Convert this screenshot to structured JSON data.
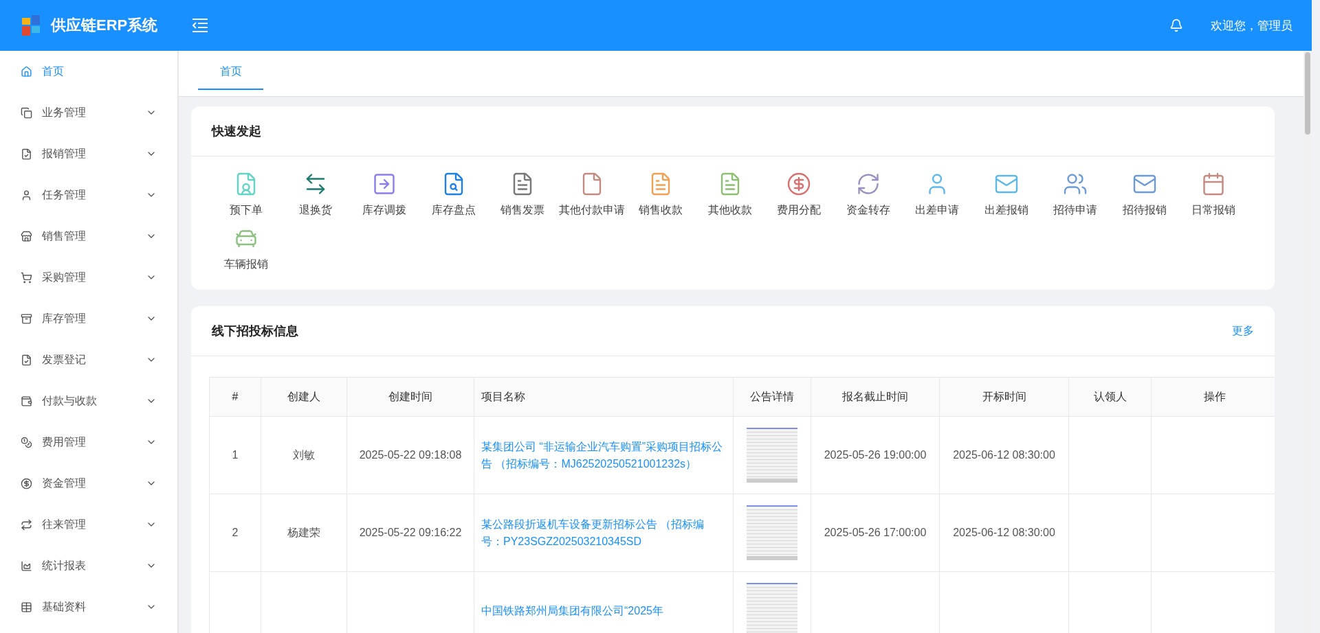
{
  "header": {
    "title": "供应链ERP系统",
    "greeting": "欢迎您，管理员"
  },
  "sidebar": {
    "items": [
      {
        "label": "首页",
        "kind": "home",
        "selected": true,
        "expandable": false
      },
      {
        "label": "业务管理",
        "kind": "window",
        "selected": false,
        "expandable": true
      },
      {
        "label": "报销管理",
        "kind": "doc-check",
        "selected": false,
        "expandable": true
      },
      {
        "label": "任务管理",
        "kind": "user",
        "selected": false,
        "expandable": true
      },
      {
        "label": "销售管理",
        "kind": "store",
        "selected": false,
        "expandable": true
      },
      {
        "label": "采购管理",
        "kind": "cart",
        "selected": false,
        "expandable": true
      },
      {
        "label": "库存管理",
        "kind": "archive",
        "selected": false,
        "expandable": true
      },
      {
        "label": "发票登记",
        "kind": "doc-check",
        "selected": false,
        "expandable": true
      },
      {
        "label": "付款与收款",
        "kind": "wallet",
        "selected": false,
        "expandable": true
      },
      {
        "label": "费用管理",
        "kind": "coins",
        "selected": false,
        "expandable": true
      },
      {
        "label": "资金管理",
        "kind": "dollar",
        "selected": false,
        "expandable": true
      },
      {
        "label": "往来管理",
        "kind": "repeat",
        "selected": false,
        "expandable": true
      },
      {
        "label": "统计报表",
        "kind": "chart",
        "selected": false,
        "expandable": true
      },
      {
        "label": "基础资料",
        "kind": "grid",
        "selected": false,
        "expandable": true
      }
    ]
  },
  "tabs": [
    {
      "label": "首页",
      "selected": true
    }
  ],
  "quick_start": {
    "title": "快速发起",
    "items": [
      {
        "label": "预下单",
        "kind": "doc-user",
        "color": "#5fd3c6"
      },
      {
        "label": "退换货",
        "kind": "swap",
        "color": "#1a7a6f"
      },
      {
        "label": "库存调拨",
        "kind": "transfer",
        "color": "#8b7cf0"
      },
      {
        "label": "库存盘点",
        "kind": "doc-search",
        "color": "#1e7fe6"
      },
      {
        "label": "销售发票",
        "kind": "doc",
        "color": "#777777"
      },
      {
        "label": "其他付款申请",
        "kind": "file",
        "color": "#c48a80"
      },
      {
        "label": "销售收款",
        "kind": "doc",
        "color": "#f0a050"
      },
      {
        "label": "其他收款",
        "kind": "doc",
        "color": "#8cc070"
      },
      {
        "label": "费用分配",
        "kind": "dollar",
        "color": "#d87070"
      },
      {
        "label": "资金转存",
        "kind": "refresh",
        "color": "#9a8fc0"
      },
      {
        "label": "出差申请",
        "kind": "user",
        "color": "#5bb8e8"
      },
      {
        "label": "出差报销",
        "kind": "envelope",
        "color": "#5bb8e8"
      },
      {
        "label": "招待申请",
        "kind": "users",
        "color": "#6a9ad8"
      },
      {
        "label": "招待报销",
        "kind": "envelope",
        "color": "#6a9ad8"
      },
      {
        "label": "日常报销",
        "kind": "calendar",
        "color": "#c48a80"
      },
      {
        "label": "车辆报销",
        "kind": "car",
        "color": "#8cc080"
      }
    ]
  },
  "bids": {
    "title": "线下招投标信息",
    "more": "更多",
    "table": {
      "columns": [
        "#",
        "创建人",
        "创建时间",
        "项目名称",
        "公告详情",
        "报名截止时间",
        "开标时间",
        "认领人",
        "操作"
      ],
      "rows": [
        {
          "index": "1",
          "creator": "刘敏",
          "created": "2025-05-22 09:18:08",
          "project": "某集团公司 “非运输企业汽车购置”采购项目招标公告 （招标编号：MJ62520250521001232s）",
          "deadline": "2025-05-26 19:00:00",
          "opening": "2025-06-12 08:30:00"
        },
        {
          "index": "2",
          "creator": "杨建荣",
          "created": "2025-05-22 09:16:22",
          "project": "某公路段折返机车设备更新招标公告 （招标编号：PY23SGZ202503210345SD",
          "deadline": "2025-05-26 17:00:00",
          "opening": "2025-06-12 08:30:00"
        },
        {
          "index": "",
          "creator": "",
          "created": "",
          "project": "中国铁路郑州局集团有限公司“2025年",
          "deadline": "",
          "opening": ""
        }
      ]
    }
  }
}
